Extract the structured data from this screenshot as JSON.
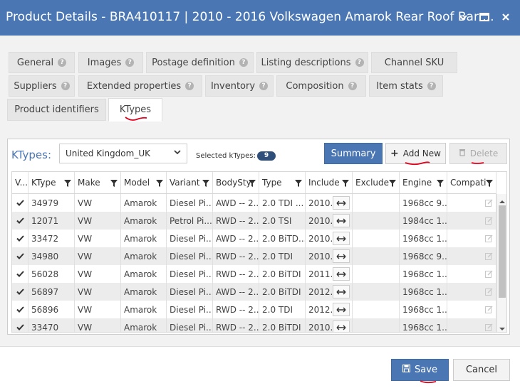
{
  "window": {
    "title": "Product Details - BRA410117 | 2010 - 2016 Volkswagen Amarok Rear Roof Bar ...",
    "controls": [
      "chevron-down-icon",
      "maximize-icon",
      "close-icon"
    ]
  },
  "tabs": {
    "row1": [
      "General",
      "Images",
      "Postage definition",
      "Listing descriptions",
      "Channel SKU"
    ],
    "row2": [
      "Suppliers",
      "Extended properties",
      "Inventory",
      "Composition",
      "Item stats"
    ],
    "row3": [
      "Product identifiers",
      "KTypes"
    ],
    "active": "KTypes"
  },
  "ktypes": {
    "label": "KTypes:",
    "country": "United Kingdom_UK",
    "selected_label": "Selected kTypes:",
    "selected_count": "9",
    "summary_label": "Summary",
    "add_new_label": "Add New",
    "delete_label": "Delete"
  },
  "grid": {
    "columns": [
      "V...",
      "KType",
      "Make",
      "Model",
      "Variant",
      "BodySty",
      "Type",
      "Include",
      "Exclude",
      "Engine",
      "Compati"
    ],
    "rows": [
      {
        "ktype": "34979",
        "make": "VW",
        "model": "Amarok",
        "variant": "Diesel Pi...",
        "body": "AWD -- 2...",
        "type": "2.0 TDI ...",
        "include": "2010...",
        "engine": "1968cc 9..."
      },
      {
        "ktype": "12071",
        "make": "VW",
        "model": "Amarok",
        "variant": "Petrol Pi...",
        "body": "RWD -- 2...",
        "type": "2.0 TSI",
        "include": "2010...",
        "engine": "1984cc 1..."
      },
      {
        "ktype": "33472",
        "make": "VW",
        "model": "Amarok",
        "variant": "Diesel Pi...",
        "body": "AWD -- 2...",
        "type": "2.0 BiTD...",
        "include": "2010...",
        "engine": "1968cc 1..."
      },
      {
        "ktype": "34980",
        "make": "VW",
        "model": "Amarok",
        "variant": "Diesel Pi...",
        "body": "RWD -- 2...",
        "type": "2.0 TDI",
        "include": "2010...",
        "engine": "1968cc 9..."
      },
      {
        "ktype": "56028",
        "make": "VW",
        "model": "Amarok",
        "variant": "Diesel Pi...",
        "body": "RWD -- 2...",
        "type": "2.0 BiTDI",
        "include": "2011...",
        "engine": "1968cc 1..."
      },
      {
        "ktype": "56897",
        "make": "VW",
        "model": "Amarok",
        "variant": "Diesel Pi...",
        "body": "AWD -- 2...",
        "type": "2.0 BiTDI",
        "include": "2012...",
        "engine": "1968cc 1..."
      },
      {
        "ktype": "56896",
        "make": "VW",
        "model": "Amarok",
        "variant": "Diesel Pi...",
        "body": "RWD -- 2...",
        "type": "2.0 TDI",
        "include": "2012...",
        "engine": "1968cc 1..."
      },
      {
        "ktype": "33470",
        "make": "VW",
        "model": "Amarok",
        "variant": "Diesel Pi...",
        "body": "RWD -- 2...",
        "type": "2.0 BiTDI",
        "include": "2010...",
        "engine": "1968cc 1..."
      }
    ]
  },
  "footer": {
    "save_label": "Save",
    "cancel_label": "Cancel"
  },
  "colors": {
    "accent": "#4a76b4",
    "badge": "#2f4f7a",
    "annotation": "#e0001b"
  }
}
